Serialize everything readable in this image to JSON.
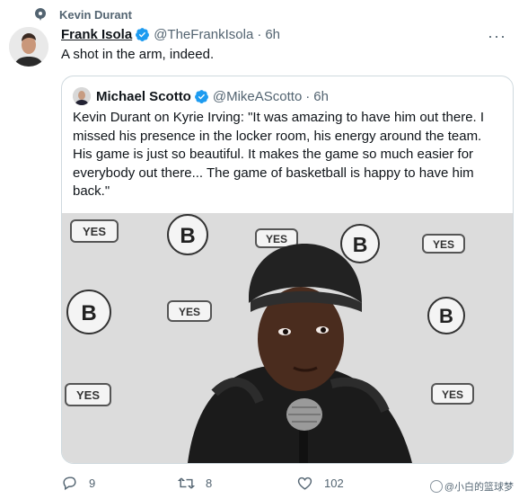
{
  "context": {
    "icon": "topic-bubble-icon",
    "text": "Kevin Durant"
  },
  "tweet": {
    "author_name": "Frank Isola",
    "author_handle": "@TheFrankIsola",
    "separator": "·",
    "time": "6h",
    "text": "A shot in the arm, indeed.",
    "more": "···"
  },
  "quote": {
    "author_name": "Michael Scotto",
    "author_handle": "@MikeAScotto",
    "separator": "·",
    "time": "6h",
    "text": "Kevin Durant on Kyrie Irving: \"It was amazing to have him out there. I missed his presence in the locker room, his energy around the team. His game is just so beautiful. It makes the game so much easier for everybody out there... The game of basketball is happy to have him back.\"",
    "media": {
      "backdrop_logos": [
        "YES",
        "B"
      ]
    }
  },
  "actions": {
    "replies": "9",
    "retweets": "8",
    "likes": "102"
  },
  "watermark": {
    "text": "@小白的篮球梦"
  },
  "colors": {
    "verified": "#1d9bf0",
    "secondary_text": "#536471",
    "border": "#cfd9de"
  }
}
